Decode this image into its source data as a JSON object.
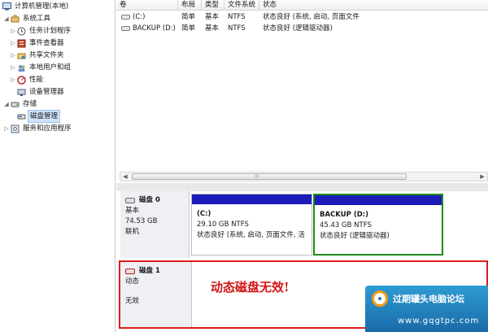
{
  "tree": {
    "root": "计算机管理(本地)",
    "items": [
      {
        "label": "系统工具",
        "icon": "tools-icon"
      },
      {
        "label": "任务计划程序",
        "icon": "clock-icon"
      },
      {
        "label": "事件查看器",
        "icon": "event-viewer-icon"
      },
      {
        "label": "共享文件夹",
        "icon": "shared-folder-icon"
      },
      {
        "label": "本地用户和组",
        "icon": "users-icon"
      },
      {
        "label": "性能",
        "icon": "performance-icon"
      },
      {
        "label": "设备管理器",
        "icon": "device-manager-icon"
      },
      {
        "label": "存储",
        "icon": "storage-icon"
      },
      {
        "label": "磁盘管理",
        "icon": "disk-management-icon"
      },
      {
        "label": "服务和应用程序",
        "icon": "services-icon"
      }
    ]
  },
  "columns": [
    "卷",
    "布局",
    "类型",
    "文件系统",
    "状态"
  ],
  "volumes": [
    {
      "name": "(C:)",
      "layout": "简单",
      "type": "基本",
      "fs": "NTFS",
      "status": "状态良好 (系统, 启动, 页面文件"
    },
    {
      "name": "BACKUP (D:)",
      "layout": "简单",
      "type": "基本",
      "fs": "NTFS",
      "status": "状态良好 (逻辑驱动器)"
    }
  ],
  "disk0": {
    "name": "磁盘 0",
    "type": "基本",
    "size": "74.53 GB",
    "state": "联机",
    "partitions": [
      {
        "name": "(C:)",
        "size": "29.10 GB NTFS",
        "status": "状态良好 (系统, 启动, 页面文件, 活"
      },
      {
        "name": "BACKUP  (D:)",
        "size": "45.43 GB NTFS",
        "status": "状态良好 (逻辑驱动器)"
      }
    ]
  },
  "disk1": {
    "name": "磁盘 1",
    "type": "动态",
    "state": "无效",
    "warning": "动态磁盘无效!"
  },
  "watermark": {
    "title": "过期罐头电脑论坛",
    "url": "www.gqgtpc.com"
  },
  "colors": {
    "partition_bar": "#1b1bb8",
    "selected_border": "#1e8a1e",
    "warning_red": "#e01c1c"
  }
}
